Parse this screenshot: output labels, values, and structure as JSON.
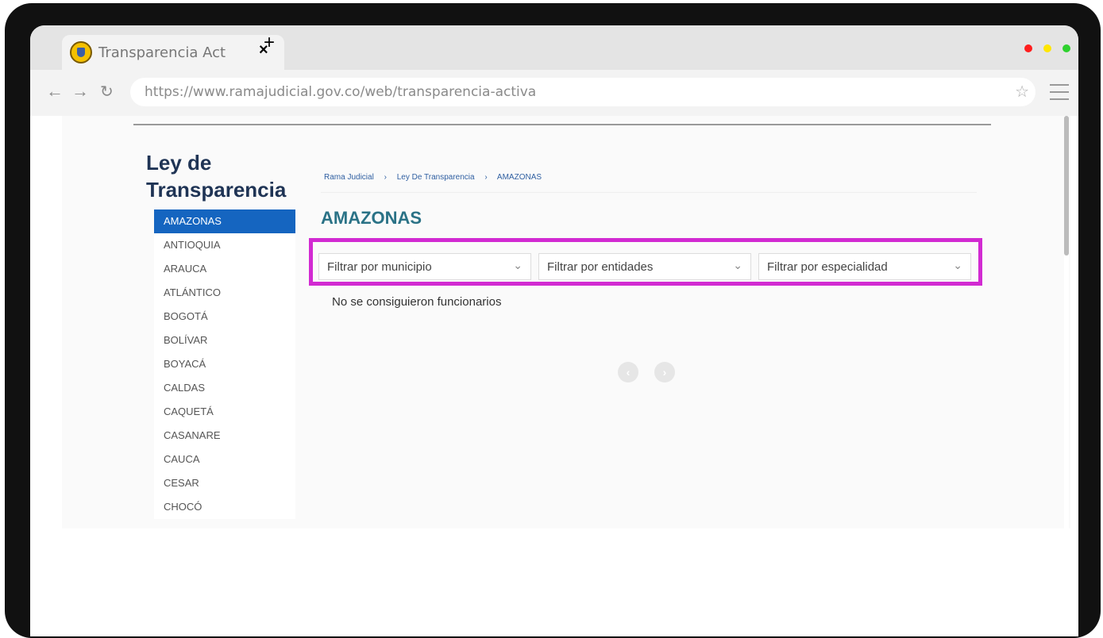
{
  "browser": {
    "tab_title": "Transparencia Act",
    "tab_close": "×",
    "new_tab": "+",
    "url": "https://www.ramajudicial.gov.co/web/transparencia-activa",
    "window_dots": [
      "#ff1e1e",
      "#ffe600",
      "#2ed12e"
    ]
  },
  "page": {
    "title": "Ley de Transparencia",
    "sidebar": {
      "items": [
        {
          "label": "AMAZONAS",
          "active": true
        },
        {
          "label": "ANTIOQUIA"
        },
        {
          "label": "ARAUCA"
        },
        {
          "label": "ATLÁNTICO"
        },
        {
          "label": "BOGOTÁ"
        },
        {
          "label": "BOLÍVAR"
        },
        {
          "label": "BOYACÁ"
        },
        {
          "label": "CALDAS"
        },
        {
          "label": "CAQUETÁ"
        },
        {
          "label": "CASANARE"
        },
        {
          "label": "CAUCA"
        },
        {
          "label": "CESAR"
        },
        {
          "label": "CHOCÓ"
        }
      ]
    },
    "breadcrumb": [
      "Rama Judicial",
      "Ley De Transparencia",
      "AMAZONAS"
    ],
    "section_title": "AMAZONAS",
    "filters": [
      {
        "label": "Filtrar por municipio"
      },
      {
        "label": "Filtrar por entidades"
      },
      {
        "label": "Filtrar por especialidad"
      }
    ],
    "empty_message": "No se consiguieron funcionarios",
    "highlight_color": "#d22ad2"
  }
}
